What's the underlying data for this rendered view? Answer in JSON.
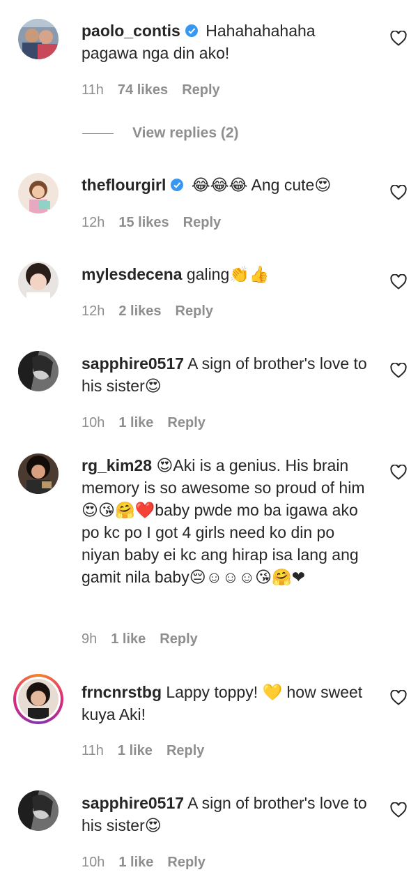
{
  "comments": [
    {
      "username": "paolo_contis",
      "verified": true,
      "text": " Hahahahahaha pagawa nga din ako!",
      "time": "11h",
      "likes": "74 likes",
      "reply": "Reply",
      "view_replies": "View replies (2)"
    },
    {
      "username": "theflourgirl",
      "verified": true,
      "text": " 😂😂😂 Ang cute😍",
      "time": "12h",
      "likes": "15 likes",
      "reply": "Reply"
    },
    {
      "username": "mylesdecena",
      "verified": false,
      "text": " galing👏👍",
      "time": "12h",
      "likes": "2 likes",
      "reply": "Reply"
    },
    {
      "username": "sapphire0517",
      "verified": false,
      "text": " A sign of brother's love to his sister😍",
      "time": "10h",
      "likes": "1 like",
      "reply": "Reply"
    },
    {
      "username": "rg_kim28",
      "verified": false,
      "text": " 😍Aki is a genius. His brain memory is so awesome so proud of him😍😘🤗❤️baby pwde mo ba igawa ako po kc po I got 4 girls need ko din po niyan baby ei kc ang hirap isa lang ang gamit nila baby😔☺☺☺😘🤗❤",
      "time": "9h",
      "likes": "1 like",
      "reply": "Reply"
    },
    {
      "username": "frncnrstbg",
      "verified": false,
      "text": " Lappy toppy! 💛 how sweet kuya Aki!",
      "time": "11h",
      "likes": "1 like",
      "reply": "Reply"
    },
    {
      "username": "sapphire0517",
      "verified": false,
      "text": " A sign of brother's love to his sister😍",
      "time": "10h",
      "likes": "1 like",
      "reply": "Reply"
    }
  ],
  "icons": {
    "like": "heart-outline-icon",
    "verified": "verified-badge-icon"
  },
  "colors": {
    "verified_blue": "#3897f0",
    "meta_gray": "#8e8e8e",
    "text": "#262626"
  }
}
